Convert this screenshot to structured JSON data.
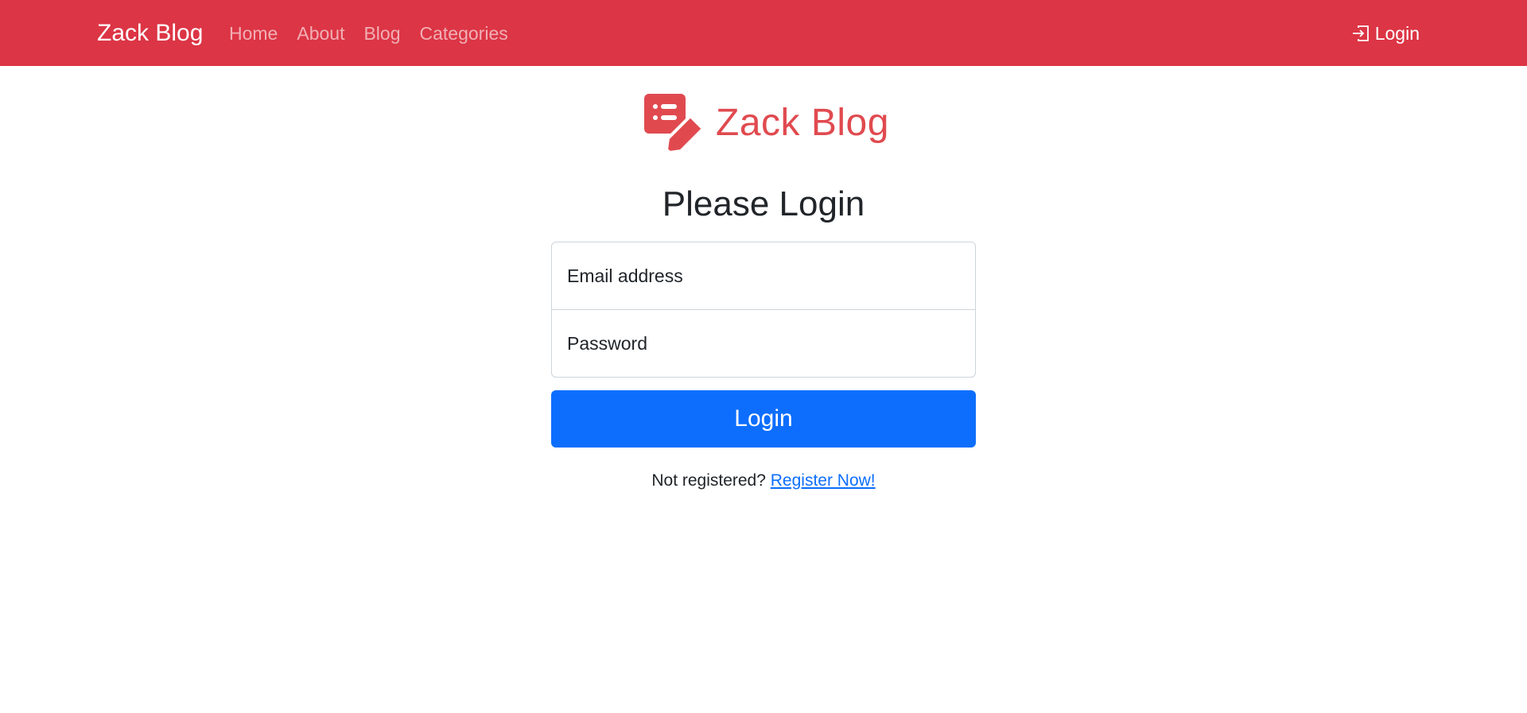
{
  "navbar": {
    "brand": "Zack Blog",
    "links": [
      "Home",
      "About",
      "Blog",
      "Categories"
    ],
    "login_label": "Login",
    "login_icon": "box-arrow-in-right-icon",
    "background": "#dc3545"
  },
  "logo": {
    "text": "Zack Blog",
    "icon": "list-with-pencil-icon",
    "color": "#e04a4f"
  },
  "main": {
    "heading": "Please Login",
    "email_placeholder": "Email address",
    "password_placeholder": "Password",
    "login_button": "Login",
    "button_color": "#0d6efd",
    "register_prompt": "Not registered?",
    "register_link": "Register Now!"
  }
}
